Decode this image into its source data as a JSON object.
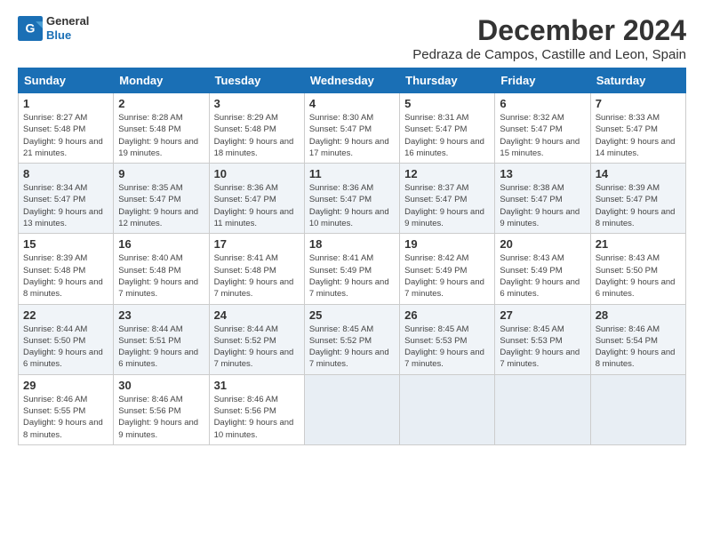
{
  "logo": {
    "line1": "General",
    "line2": "Blue"
  },
  "title": "December 2024",
  "subtitle": "Pedraza de Campos, Castille and Leon, Spain",
  "days_header": [
    "Sunday",
    "Monday",
    "Tuesday",
    "Wednesday",
    "Thursday",
    "Friday",
    "Saturday"
  ],
  "weeks": [
    [
      {
        "day": "1",
        "sunrise": "Sunrise: 8:27 AM",
        "sunset": "Sunset: 5:48 PM",
        "daylight": "Daylight: 9 hours and 21 minutes."
      },
      {
        "day": "2",
        "sunrise": "Sunrise: 8:28 AM",
        "sunset": "Sunset: 5:48 PM",
        "daylight": "Daylight: 9 hours and 19 minutes."
      },
      {
        "day": "3",
        "sunrise": "Sunrise: 8:29 AM",
        "sunset": "Sunset: 5:48 PM",
        "daylight": "Daylight: 9 hours and 18 minutes."
      },
      {
        "day": "4",
        "sunrise": "Sunrise: 8:30 AM",
        "sunset": "Sunset: 5:47 PM",
        "daylight": "Daylight: 9 hours and 17 minutes."
      },
      {
        "day": "5",
        "sunrise": "Sunrise: 8:31 AM",
        "sunset": "Sunset: 5:47 PM",
        "daylight": "Daylight: 9 hours and 16 minutes."
      },
      {
        "day": "6",
        "sunrise": "Sunrise: 8:32 AM",
        "sunset": "Sunset: 5:47 PM",
        "daylight": "Daylight: 9 hours and 15 minutes."
      },
      {
        "day": "7",
        "sunrise": "Sunrise: 8:33 AM",
        "sunset": "Sunset: 5:47 PM",
        "daylight": "Daylight: 9 hours and 14 minutes."
      }
    ],
    [
      {
        "day": "8",
        "sunrise": "Sunrise: 8:34 AM",
        "sunset": "Sunset: 5:47 PM",
        "daylight": "Daylight: 9 hours and 13 minutes."
      },
      {
        "day": "9",
        "sunrise": "Sunrise: 8:35 AM",
        "sunset": "Sunset: 5:47 PM",
        "daylight": "Daylight: 9 hours and 12 minutes."
      },
      {
        "day": "10",
        "sunrise": "Sunrise: 8:36 AM",
        "sunset": "Sunset: 5:47 PM",
        "daylight": "Daylight: 9 hours and 11 minutes."
      },
      {
        "day": "11",
        "sunrise": "Sunrise: 8:36 AM",
        "sunset": "Sunset: 5:47 PM",
        "daylight": "Daylight: 9 hours and 10 minutes."
      },
      {
        "day": "12",
        "sunrise": "Sunrise: 8:37 AM",
        "sunset": "Sunset: 5:47 PM",
        "daylight": "Daylight: 9 hours and 9 minutes."
      },
      {
        "day": "13",
        "sunrise": "Sunrise: 8:38 AM",
        "sunset": "Sunset: 5:47 PM",
        "daylight": "Daylight: 9 hours and 9 minutes."
      },
      {
        "day": "14",
        "sunrise": "Sunrise: 8:39 AM",
        "sunset": "Sunset: 5:47 PM",
        "daylight": "Daylight: 9 hours and 8 minutes."
      }
    ],
    [
      {
        "day": "15",
        "sunrise": "Sunrise: 8:39 AM",
        "sunset": "Sunset: 5:48 PM",
        "daylight": "Daylight: 9 hours and 8 minutes."
      },
      {
        "day": "16",
        "sunrise": "Sunrise: 8:40 AM",
        "sunset": "Sunset: 5:48 PM",
        "daylight": "Daylight: 9 hours and 7 minutes."
      },
      {
        "day": "17",
        "sunrise": "Sunrise: 8:41 AM",
        "sunset": "Sunset: 5:48 PM",
        "daylight": "Daylight: 9 hours and 7 minutes."
      },
      {
        "day": "18",
        "sunrise": "Sunrise: 8:41 AM",
        "sunset": "Sunset: 5:49 PM",
        "daylight": "Daylight: 9 hours and 7 minutes."
      },
      {
        "day": "19",
        "sunrise": "Sunrise: 8:42 AM",
        "sunset": "Sunset: 5:49 PM",
        "daylight": "Daylight: 9 hours and 7 minutes."
      },
      {
        "day": "20",
        "sunrise": "Sunrise: 8:43 AM",
        "sunset": "Sunset: 5:49 PM",
        "daylight": "Daylight: 9 hours and 6 minutes."
      },
      {
        "day": "21",
        "sunrise": "Sunrise: 8:43 AM",
        "sunset": "Sunset: 5:50 PM",
        "daylight": "Daylight: 9 hours and 6 minutes."
      }
    ],
    [
      {
        "day": "22",
        "sunrise": "Sunrise: 8:44 AM",
        "sunset": "Sunset: 5:50 PM",
        "daylight": "Daylight: 9 hours and 6 minutes."
      },
      {
        "day": "23",
        "sunrise": "Sunrise: 8:44 AM",
        "sunset": "Sunset: 5:51 PM",
        "daylight": "Daylight: 9 hours and 6 minutes."
      },
      {
        "day": "24",
        "sunrise": "Sunrise: 8:44 AM",
        "sunset": "Sunset: 5:52 PM",
        "daylight": "Daylight: 9 hours and 7 minutes."
      },
      {
        "day": "25",
        "sunrise": "Sunrise: 8:45 AM",
        "sunset": "Sunset: 5:52 PM",
        "daylight": "Daylight: 9 hours and 7 minutes."
      },
      {
        "day": "26",
        "sunrise": "Sunrise: 8:45 AM",
        "sunset": "Sunset: 5:53 PM",
        "daylight": "Daylight: 9 hours and 7 minutes."
      },
      {
        "day": "27",
        "sunrise": "Sunrise: 8:45 AM",
        "sunset": "Sunset: 5:53 PM",
        "daylight": "Daylight: 9 hours and 7 minutes."
      },
      {
        "day": "28",
        "sunrise": "Sunrise: 8:46 AM",
        "sunset": "Sunset: 5:54 PM",
        "daylight": "Daylight: 9 hours and 8 minutes."
      }
    ],
    [
      {
        "day": "29",
        "sunrise": "Sunrise: 8:46 AM",
        "sunset": "Sunset: 5:55 PM",
        "daylight": "Daylight: 9 hours and 8 minutes."
      },
      {
        "day": "30",
        "sunrise": "Sunrise: 8:46 AM",
        "sunset": "Sunset: 5:56 PM",
        "daylight": "Daylight: 9 hours and 9 minutes."
      },
      {
        "day": "31",
        "sunrise": "Sunrise: 8:46 AM",
        "sunset": "Sunset: 5:56 PM",
        "daylight": "Daylight: 9 hours and 10 minutes."
      },
      null,
      null,
      null,
      null
    ]
  ]
}
